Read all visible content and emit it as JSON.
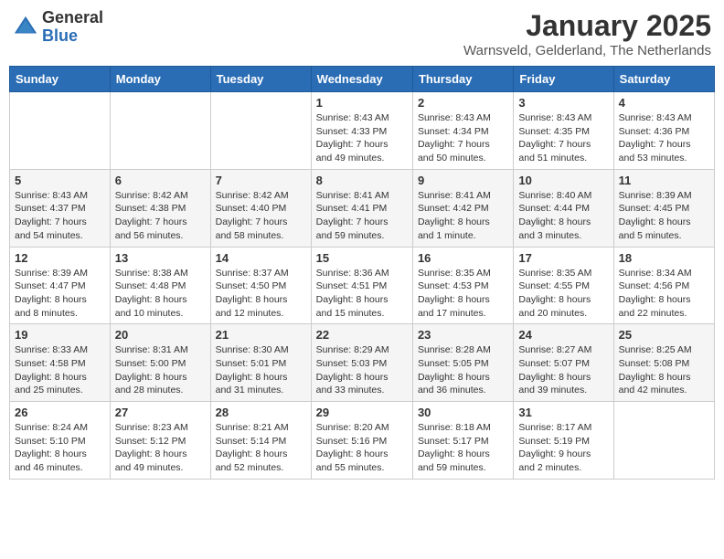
{
  "header": {
    "logo_general": "General",
    "logo_blue": "Blue",
    "month_year": "January 2025",
    "location": "Warnsveld, Gelderland, The Netherlands"
  },
  "weekdays": [
    "Sunday",
    "Monday",
    "Tuesday",
    "Wednesday",
    "Thursday",
    "Friday",
    "Saturday"
  ],
  "weeks": [
    [
      {
        "day": "",
        "info": ""
      },
      {
        "day": "",
        "info": ""
      },
      {
        "day": "",
        "info": ""
      },
      {
        "day": "1",
        "info": "Sunrise: 8:43 AM\nSunset: 4:33 PM\nDaylight: 7 hours\nand 49 minutes."
      },
      {
        "day": "2",
        "info": "Sunrise: 8:43 AM\nSunset: 4:34 PM\nDaylight: 7 hours\nand 50 minutes."
      },
      {
        "day": "3",
        "info": "Sunrise: 8:43 AM\nSunset: 4:35 PM\nDaylight: 7 hours\nand 51 minutes."
      },
      {
        "day": "4",
        "info": "Sunrise: 8:43 AM\nSunset: 4:36 PM\nDaylight: 7 hours\nand 53 minutes."
      }
    ],
    [
      {
        "day": "5",
        "info": "Sunrise: 8:43 AM\nSunset: 4:37 PM\nDaylight: 7 hours\nand 54 minutes."
      },
      {
        "day": "6",
        "info": "Sunrise: 8:42 AM\nSunset: 4:38 PM\nDaylight: 7 hours\nand 56 minutes."
      },
      {
        "day": "7",
        "info": "Sunrise: 8:42 AM\nSunset: 4:40 PM\nDaylight: 7 hours\nand 58 minutes."
      },
      {
        "day": "8",
        "info": "Sunrise: 8:41 AM\nSunset: 4:41 PM\nDaylight: 7 hours\nand 59 minutes."
      },
      {
        "day": "9",
        "info": "Sunrise: 8:41 AM\nSunset: 4:42 PM\nDaylight: 8 hours\nand 1 minute."
      },
      {
        "day": "10",
        "info": "Sunrise: 8:40 AM\nSunset: 4:44 PM\nDaylight: 8 hours\nand 3 minutes."
      },
      {
        "day": "11",
        "info": "Sunrise: 8:39 AM\nSunset: 4:45 PM\nDaylight: 8 hours\nand 5 minutes."
      }
    ],
    [
      {
        "day": "12",
        "info": "Sunrise: 8:39 AM\nSunset: 4:47 PM\nDaylight: 8 hours\nand 8 minutes."
      },
      {
        "day": "13",
        "info": "Sunrise: 8:38 AM\nSunset: 4:48 PM\nDaylight: 8 hours\nand 10 minutes."
      },
      {
        "day": "14",
        "info": "Sunrise: 8:37 AM\nSunset: 4:50 PM\nDaylight: 8 hours\nand 12 minutes."
      },
      {
        "day": "15",
        "info": "Sunrise: 8:36 AM\nSunset: 4:51 PM\nDaylight: 8 hours\nand 15 minutes."
      },
      {
        "day": "16",
        "info": "Sunrise: 8:35 AM\nSunset: 4:53 PM\nDaylight: 8 hours\nand 17 minutes."
      },
      {
        "day": "17",
        "info": "Sunrise: 8:35 AM\nSunset: 4:55 PM\nDaylight: 8 hours\nand 20 minutes."
      },
      {
        "day": "18",
        "info": "Sunrise: 8:34 AM\nSunset: 4:56 PM\nDaylight: 8 hours\nand 22 minutes."
      }
    ],
    [
      {
        "day": "19",
        "info": "Sunrise: 8:33 AM\nSunset: 4:58 PM\nDaylight: 8 hours\nand 25 minutes."
      },
      {
        "day": "20",
        "info": "Sunrise: 8:31 AM\nSunset: 5:00 PM\nDaylight: 8 hours\nand 28 minutes."
      },
      {
        "day": "21",
        "info": "Sunrise: 8:30 AM\nSunset: 5:01 PM\nDaylight: 8 hours\nand 31 minutes."
      },
      {
        "day": "22",
        "info": "Sunrise: 8:29 AM\nSunset: 5:03 PM\nDaylight: 8 hours\nand 33 minutes."
      },
      {
        "day": "23",
        "info": "Sunrise: 8:28 AM\nSunset: 5:05 PM\nDaylight: 8 hours\nand 36 minutes."
      },
      {
        "day": "24",
        "info": "Sunrise: 8:27 AM\nSunset: 5:07 PM\nDaylight: 8 hours\nand 39 minutes."
      },
      {
        "day": "25",
        "info": "Sunrise: 8:25 AM\nSunset: 5:08 PM\nDaylight: 8 hours\nand 42 minutes."
      }
    ],
    [
      {
        "day": "26",
        "info": "Sunrise: 8:24 AM\nSunset: 5:10 PM\nDaylight: 8 hours\nand 46 minutes."
      },
      {
        "day": "27",
        "info": "Sunrise: 8:23 AM\nSunset: 5:12 PM\nDaylight: 8 hours\nand 49 minutes."
      },
      {
        "day": "28",
        "info": "Sunrise: 8:21 AM\nSunset: 5:14 PM\nDaylight: 8 hours\nand 52 minutes."
      },
      {
        "day": "29",
        "info": "Sunrise: 8:20 AM\nSunset: 5:16 PM\nDaylight: 8 hours\nand 55 minutes."
      },
      {
        "day": "30",
        "info": "Sunrise: 8:18 AM\nSunset: 5:17 PM\nDaylight: 8 hours\nand 59 minutes."
      },
      {
        "day": "31",
        "info": "Sunrise: 8:17 AM\nSunset: 5:19 PM\nDaylight: 9 hours\nand 2 minutes."
      },
      {
        "day": "",
        "info": ""
      }
    ]
  ]
}
